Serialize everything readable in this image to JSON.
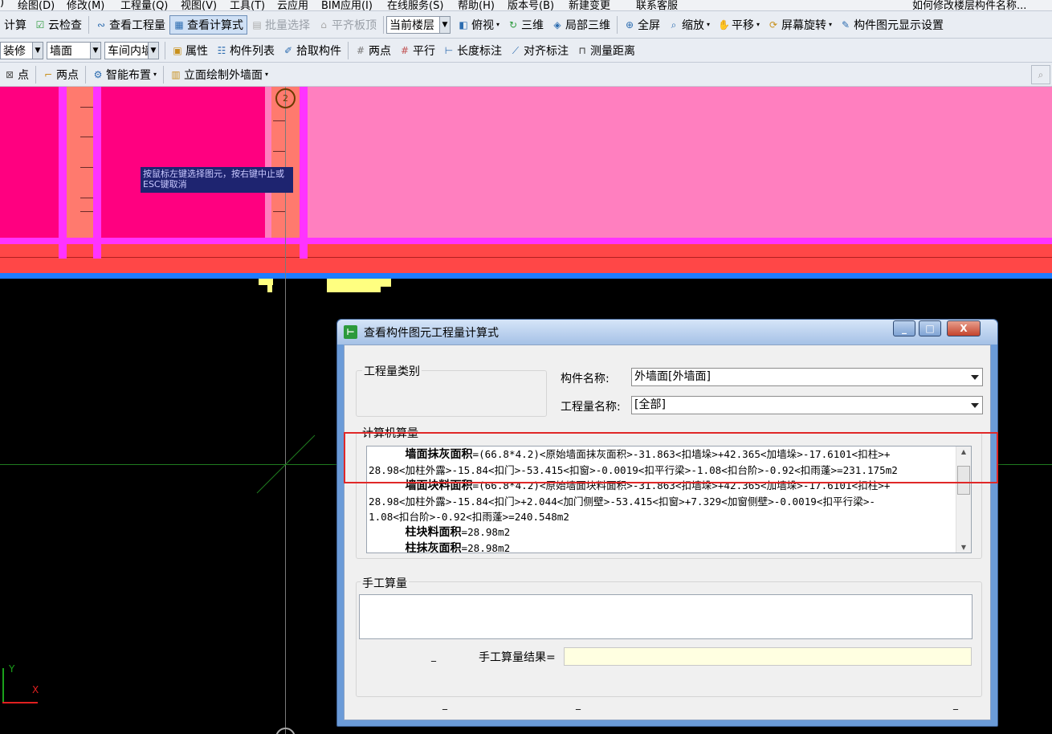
{
  "menubar": {
    "items": [
      ")",
      "绘图(D)",
      "修改(M)",
      "工程量(Q)",
      "视图(V)",
      "工具(T)",
      "云应用",
      "BIM应用(I)",
      "在线服务(S)",
      "帮助(H)",
      "版本号(B)",
      "新建变更",
      "联系客服"
    ],
    "right_hint": "如何修改楼层构件名称..."
  },
  "toolbar1": {
    "calc": "计算",
    "cloud_check": "云检查",
    "view_quantity": "查看工程量",
    "view_formula": "查看计算式",
    "batch_select": "批量选择",
    "flush_slab": "平齐板顶",
    "current_floor": "当前楼层",
    "top_view": "俯视",
    "three_d": "三维",
    "local_3d": "局部三维",
    "full_screen": "全屏",
    "zoom": "缩放",
    "pan": "平移",
    "rotate": "屏幕旋转",
    "display_settings": "构件图元显示设置"
  },
  "toolbar2": {
    "combo1": "装修",
    "combo2": "墙面",
    "combo3": "车间内墙",
    "properties": "属性",
    "component_list": "构件列表",
    "pick_component": "拾取构件",
    "two_points": "两点",
    "parallel": "平行",
    "length_dim": "长度标注",
    "aligned_dim": "对齐标注",
    "measure_distance": "测量距离"
  },
  "toolbar3": {
    "point": "点",
    "two_points": "两点",
    "smart_layout": "智能布置",
    "elevation_draw": "立面绘制外墙面"
  },
  "canvas": {
    "axis_label": "2",
    "axis_label_bottom": "2",
    "tooltip": "按鼠标左键选择图元，按右键中止或ESC键取消",
    "axis_y": "Y",
    "axis_x": "X"
  },
  "dialog": {
    "title": "查看构件图元工程量计算式",
    "min": "_",
    "max": "□",
    "close": "X",
    "quantity_type_label": "工程量类别",
    "component_name_label": "构件名称:",
    "component_name_value": "外墙面[外墙面]",
    "quantity_name_label": "工程量名称:",
    "quantity_name_value": "[全部]",
    "computer_calc_label": "计算机算量",
    "calc_lines": [
      {
        "bold": "墙面抹灰面积",
        "text": "=(66.8*4.2)<原始墙面抹灰面积>-31.863<扣墙垛>+42.365<加墙垛>-17.6101<扣柱>+"
      },
      {
        "bold": "",
        "text": "28.98<加柱外露>-15.84<扣门>-53.415<扣窗>-0.0019<扣平行梁>-1.08<扣台阶>-0.92<扣雨蓬>=231.175m2"
      },
      {
        "bold": "墙面块料面积",
        "text": "=(66.8*4.2)<原始墙面块料面积>-31.863<扣墙垛>+42.365<加墙垛>-17.6101<扣柱>+"
      },
      {
        "bold": "",
        "text": "28.98<加柱外露>-15.84<扣门>+2.044<加门侧壁>-53.415<扣窗>+7.329<加窗侧壁>-0.0019<扣平行梁>-"
      },
      {
        "bold": "",
        "text": "1.08<扣台阶>-0.92<扣雨蓬>=240.548m2"
      },
      {
        "bold": "柱块料面积",
        "text": "=28.98m2"
      },
      {
        "bold": "柱抹灰面积",
        "text": "=28.98m2"
      }
    ],
    "manual_calc_label": "手工算量",
    "manual_result_label": "手工算量结果=",
    "manual_result_value": ""
  },
  "colors": {
    "wall_pink": "#ff7fbf",
    "wall_magenta": "#ff0080",
    "highlight_red": "#e02828",
    "title_blue": "#a5c1e6"
  }
}
